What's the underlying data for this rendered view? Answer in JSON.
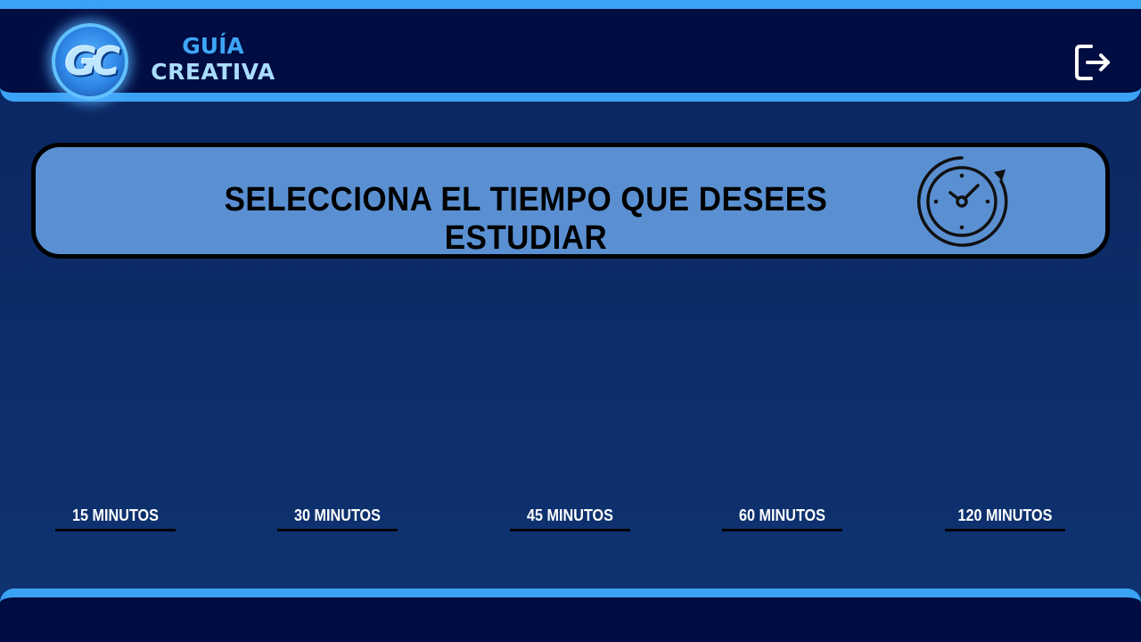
{
  "header": {
    "logo_icon": "gc-logo-icon",
    "brand_line1": "GUÍA",
    "brand_line2": "CREATIVA",
    "logout_icon": "logout-icon",
    "accent_color": "#3aa3f5",
    "bar_color": "#000d42"
  },
  "banner": {
    "title": "SELECCIONA EL TIEMPO QUE DESEES ESTUDIAR",
    "icon": "stopwatch-icon",
    "background_color": "#5a90d2"
  },
  "time_options": [
    {
      "label": "15 MINUTOS"
    },
    {
      "label": "30 MINUTOS"
    },
    {
      "label": "45 MINUTOS"
    },
    {
      "label": "60 MINUTOS"
    },
    {
      "label": "120 MINUTOS"
    }
  ]
}
